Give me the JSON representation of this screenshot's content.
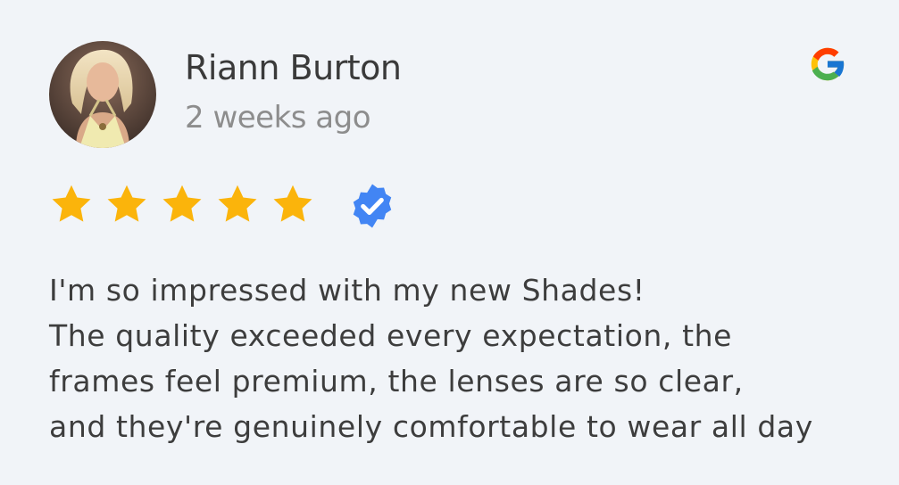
{
  "review": {
    "reviewer_name": "Riann Burton",
    "posted_ago": "2 weeks ago",
    "rating": 5,
    "rating_max": 5,
    "verified": true,
    "source_icon": "google-g-icon",
    "text_lines": [
      "I'm so impressed with my new Shades!",
      "The quality exceeded every expectation, the",
      "frames feel premium, the lenses are so clear,",
      "and they're genuinely comfortable to wear all day"
    ]
  },
  "colors": {
    "background": "#f1f4f8",
    "star": "#fbb40b",
    "verified_badge": "#4285f4",
    "name_text": "#3a3a3a",
    "time_text": "#8d8d8d",
    "body_text": "#3d3d3d"
  }
}
